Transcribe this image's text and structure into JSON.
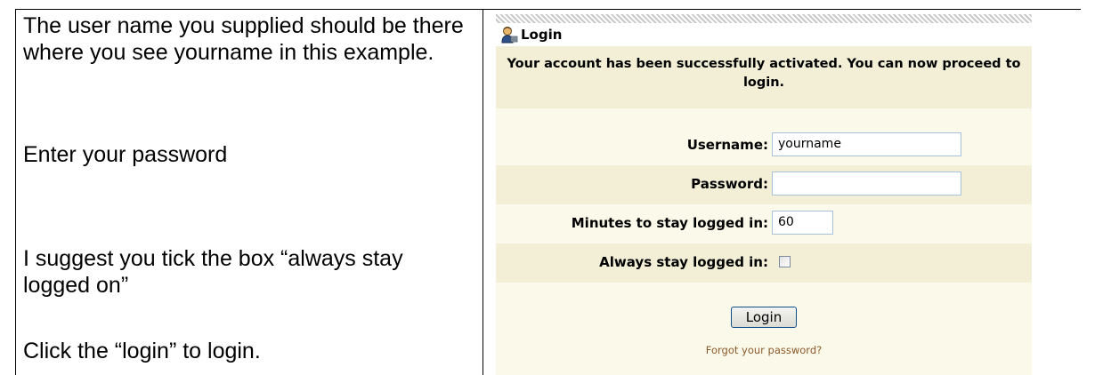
{
  "instructions": {
    "username_note": "The user name you supplied should be there where you see yourname in this example.",
    "password_note": "Enter your password",
    "checkbox_note": "I suggest you tick the box “always stay logged on”",
    "login_note": "Click  the “login” to login."
  },
  "login_panel": {
    "title": "Login",
    "icon": "user-login-icon",
    "activation_message": "Your account has been successfully activated. You can now proceed to login.",
    "fields": {
      "username": {
        "label": "Username:",
        "value": "yourname"
      },
      "password": {
        "label": "Password:",
        "value": ""
      },
      "minutes": {
        "label": "Minutes to stay logged in:",
        "value": "60"
      },
      "always": {
        "label": "Always stay logged in:",
        "checked": false
      }
    },
    "login_button": "Login",
    "forgot_link": "Forgot your password?"
  },
  "colors": {
    "panel_background": "#fbf9ea",
    "row_alt_background": "#f2efd6",
    "input_border": "#a7c1da",
    "button_border": "#0f4e8a",
    "link": "#8b5a2b"
  }
}
